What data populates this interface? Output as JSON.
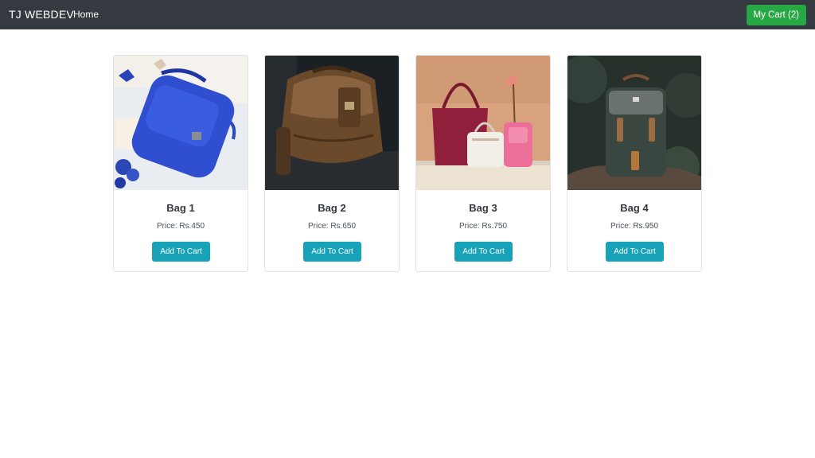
{
  "navbar": {
    "brand": "TJ WEBDEV",
    "home_label": "Home",
    "cart_label": "My Cart (2)",
    "background_color": "#343a40",
    "cart_button_color": "#28a745"
  },
  "products": [
    {
      "title": "Bag 1",
      "price": "Price: Rs.450",
      "button_label": "Add To Cart",
      "image_icon": "blue-backpack-image"
    },
    {
      "title": "Bag 2",
      "price": "Price: Rs.650",
      "button_label": "Add To Cart",
      "image_icon": "brown-leather-backpack-image"
    },
    {
      "title": "Bag 3",
      "price": "Price: Rs.750",
      "button_label": "Add To Cart",
      "image_icon": "handbags-image"
    },
    {
      "title": "Bag 4",
      "price": "Price: Rs.950",
      "button_label": "Add To Cart",
      "image_icon": "green-backpack-image"
    }
  ],
  "colors": {
    "add_button": "#17a2b8",
    "card_border": "#dfe2e6"
  }
}
